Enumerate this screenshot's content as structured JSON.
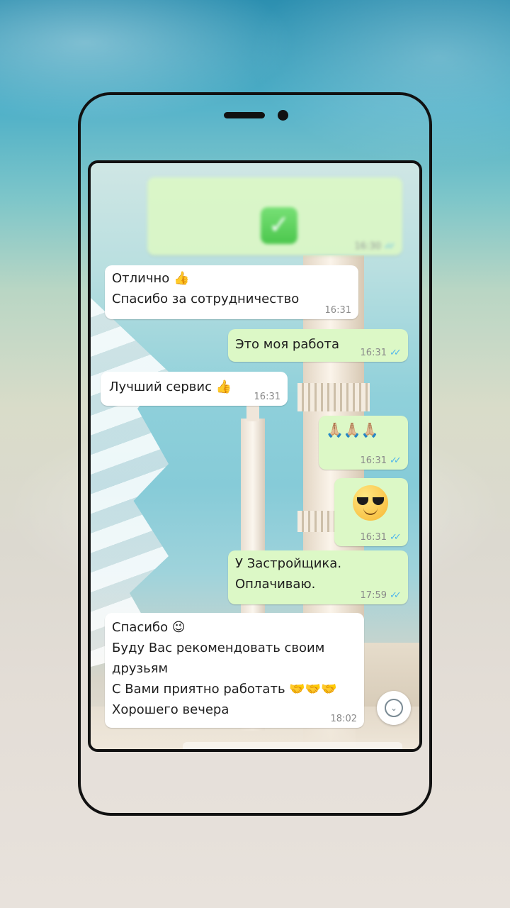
{
  "chat": {
    "blurred_message": {
      "icon": "check-mark-icon",
      "time": "16:30"
    },
    "messages": [
      {
        "lines": [
          "Отлично 👍",
          "Спасибо за сотрудничество"
        ],
        "time": "16:31",
        "direction": "in"
      },
      {
        "lines": [
          "Это моя работа"
        ],
        "time": "16:31",
        "direction": "out"
      },
      {
        "lines": [
          "Лучший сервис 👍"
        ],
        "time": "16:31",
        "direction": "in"
      },
      {
        "lines": [
          "🙏🏼🙏🏼🙏🏼"
        ],
        "time": "16:31",
        "direction": "out"
      },
      {
        "emoji": "smiling-face-with-sunglasses",
        "time": "16:31",
        "direction": "out"
      },
      {
        "lines": [
          "У Застройщика.",
          "Оплачиваю."
        ],
        "time": "17:59",
        "direction": "out"
      },
      {
        "lines": [
          "Спасибо 😉",
          "Буду Вас рекомендовать своим",
          "друзьям",
          "С Вами приятно работать 🤝🤝🤝",
          "Хорошего вечера"
        ],
        "time": "18:02",
        "direction": "in"
      }
    ]
  },
  "icons": {
    "read_receipt": "double-check-icon",
    "scroll_down": "chevron-down-icon"
  },
  "colors": {
    "incoming": "#ffffff",
    "outgoing": "#dcf8c6",
    "read_ticks": "#4fb6ec",
    "time_text": "#8a8a8a"
  }
}
